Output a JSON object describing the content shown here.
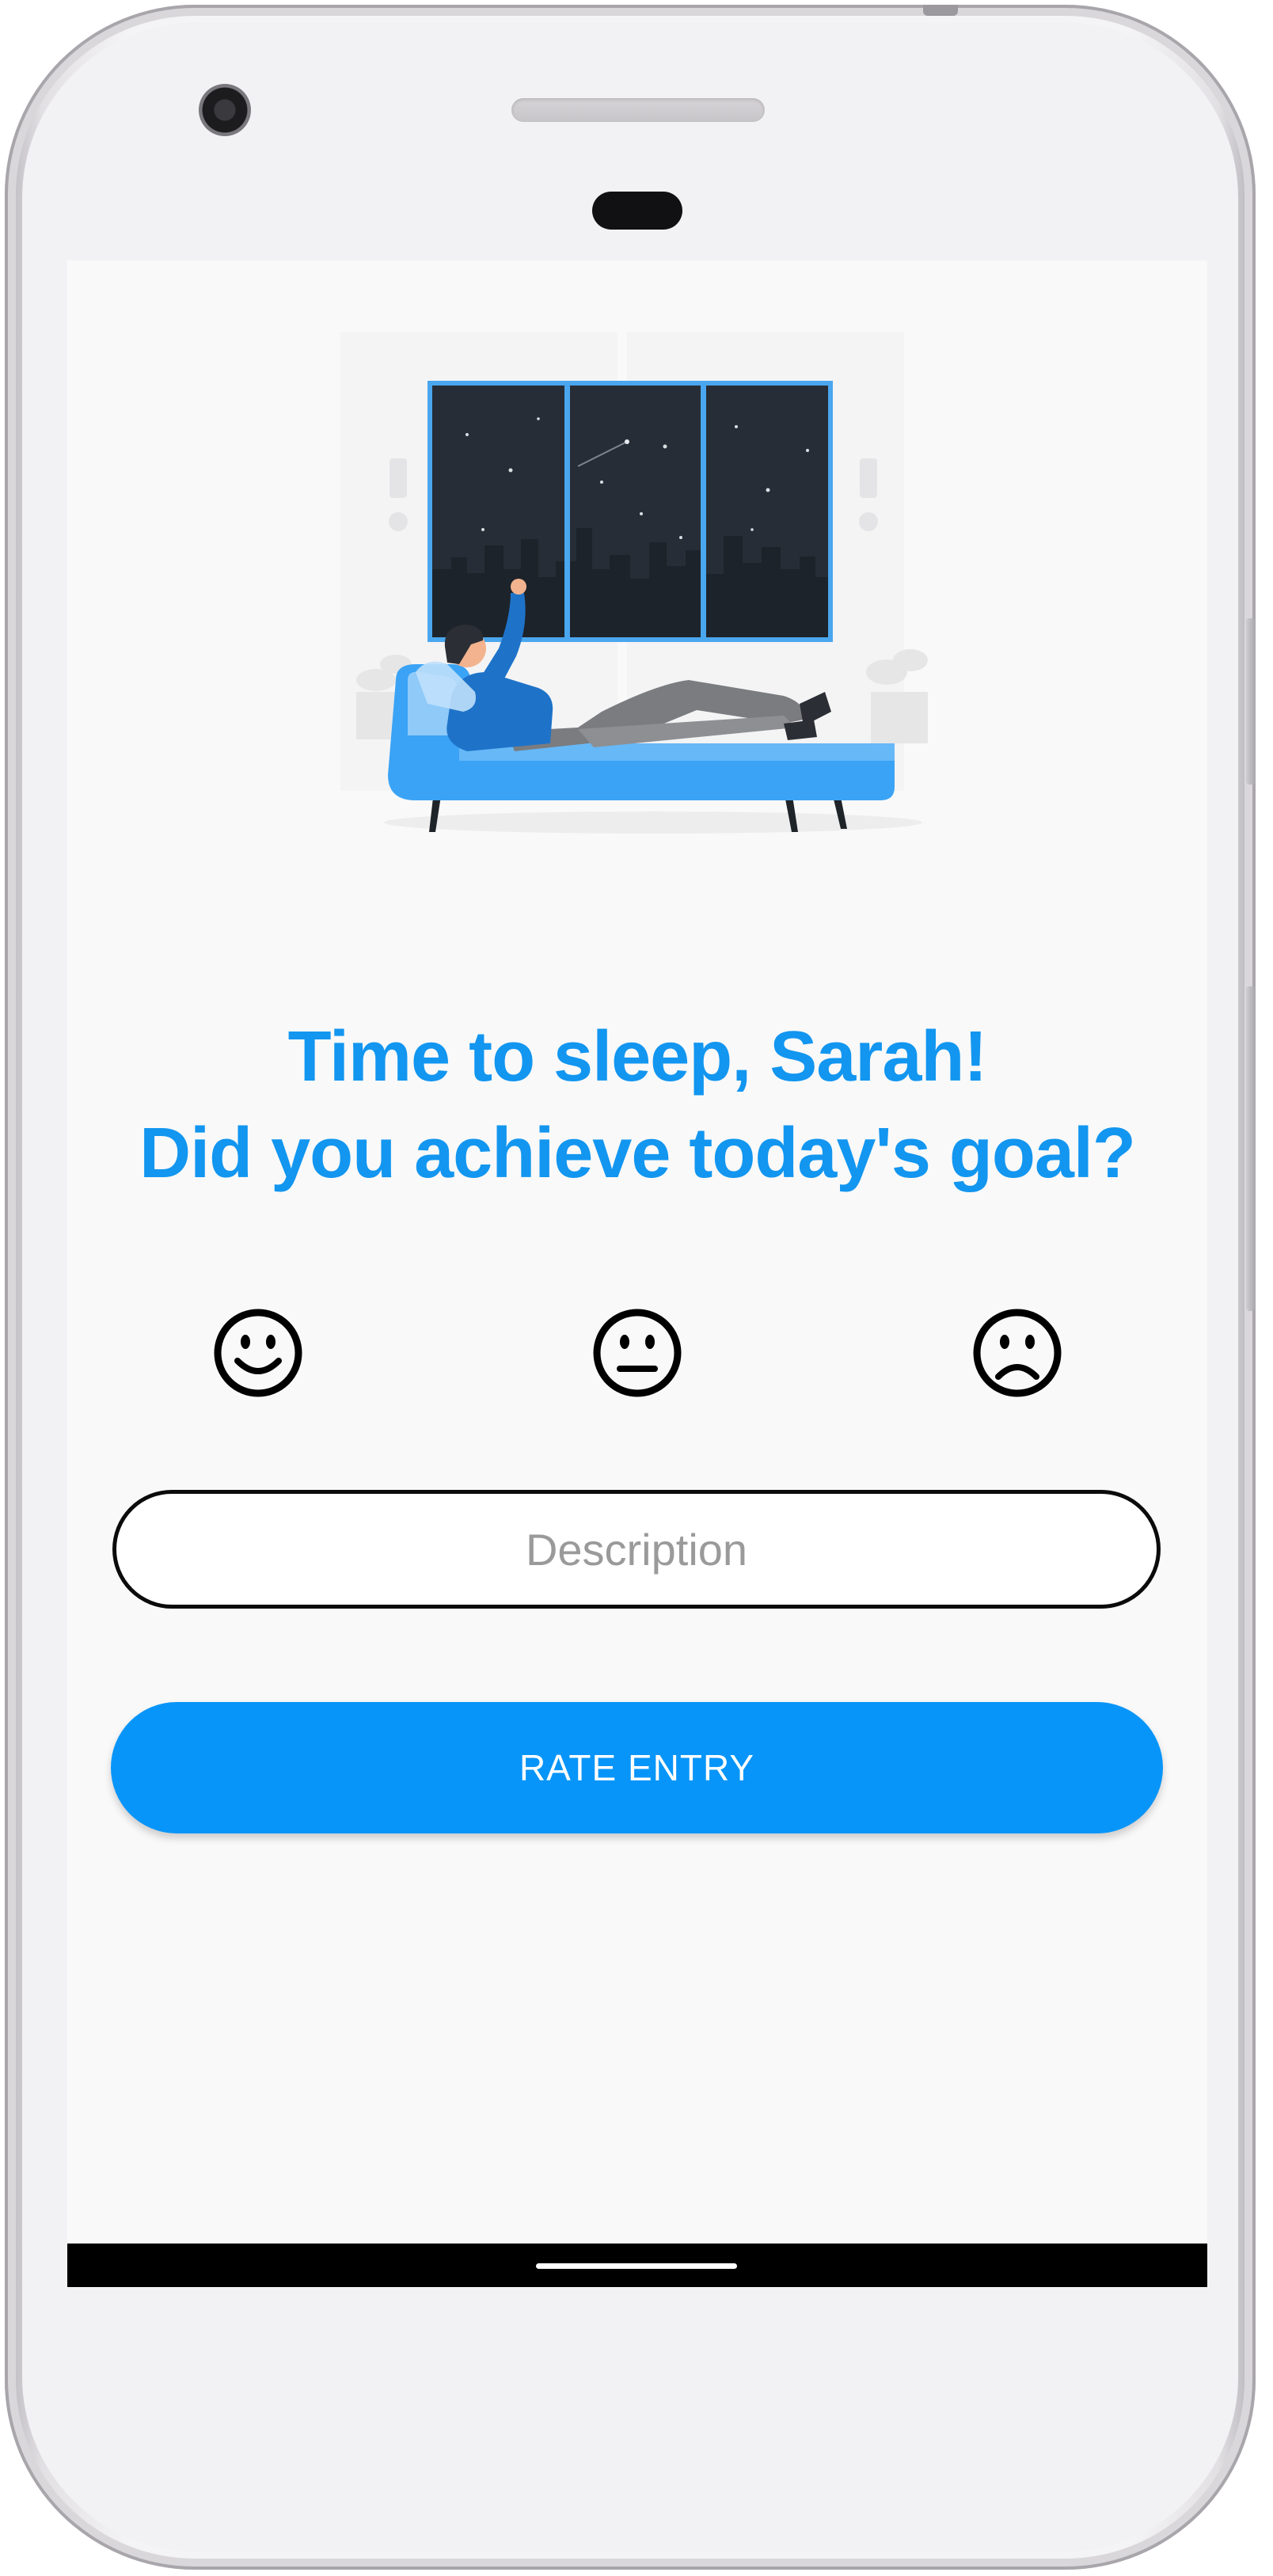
{
  "prompt": {
    "line1": "Time to sleep, Sarah!",
    "line2": "Did you achieve today's goal?"
  },
  "moods": [
    {
      "name": "happy",
      "icon": "smiling-face-icon"
    },
    {
      "name": "neutral",
      "icon": "neutral-face-icon"
    },
    {
      "name": "sad",
      "icon": "frowning-face-icon"
    }
  ],
  "description": {
    "placeholder": "Description",
    "value": ""
  },
  "actions": {
    "rate_label": "RATE ENTRY"
  },
  "illustration": {
    "icon": "person-relaxing-on-sofa-night-window-illustration"
  },
  "colors": {
    "accent": "#0895f9",
    "headline": "#1296f0",
    "screen_background": "#f9f9f9",
    "sofa": "#3aa3f5",
    "night_sky": "#262d36"
  }
}
